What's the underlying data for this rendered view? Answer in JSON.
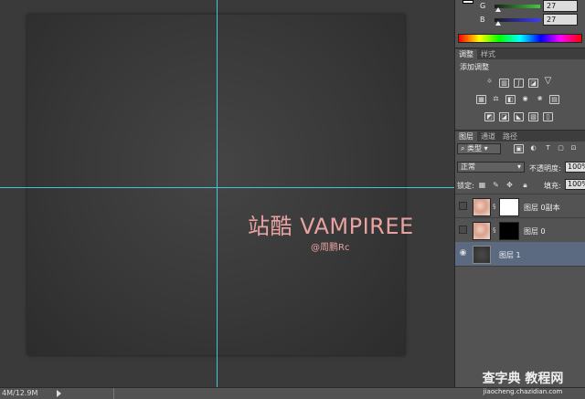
{
  "color_panel": {
    "sliders": [
      {
        "channel": "G",
        "value": "27"
      },
      {
        "channel": "B",
        "value": "27"
      }
    ]
  },
  "adjustments_panel": {
    "tabs": [
      "调整",
      "样式"
    ],
    "title": "添加调整",
    "icons": [
      "brightness-icon",
      "levels-icon",
      "curves-icon",
      "exposure-icon",
      "vibrance-icon",
      "hue-saturation-icon",
      "color-balance-icon",
      "black-white-icon",
      "photo-filter-icon",
      "channel-mixer-icon",
      "color-lookup-icon",
      "invert-icon",
      "posterize-icon",
      "threshold-icon",
      "selective-color-icon",
      "gradient-map-icon"
    ]
  },
  "layers_panel": {
    "tabs": [
      "图层",
      "通道",
      "路径"
    ],
    "filter_kind": "类型",
    "blend_mode": "正常",
    "opacity_label": "不透明度:",
    "opacity_value": "100%",
    "lock_label": "锁定:",
    "fill_label": "填充:",
    "fill_value": "100%",
    "layers": [
      {
        "name": "图层 0副本",
        "visible": false,
        "mask": "white"
      },
      {
        "name": "图层 0",
        "visible": false,
        "mask": "black"
      },
      {
        "name": "图层 1",
        "visible": true,
        "selected": true
      }
    ]
  },
  "canvas": {
    "title": "站酷 VAMPIREE",
    "subtitle": "@周鹏Rc",
    "text_color": "#e8a2a2",
    "guide_color": "#3fc6d6"
  },
  "status_bar": {
    "doc_size": "4M/12.9M"
  },
  "watermark": {
    "line1": "查字典 教程网",
    "line2": "jiaocheng.chazidian.com"
  }
}
